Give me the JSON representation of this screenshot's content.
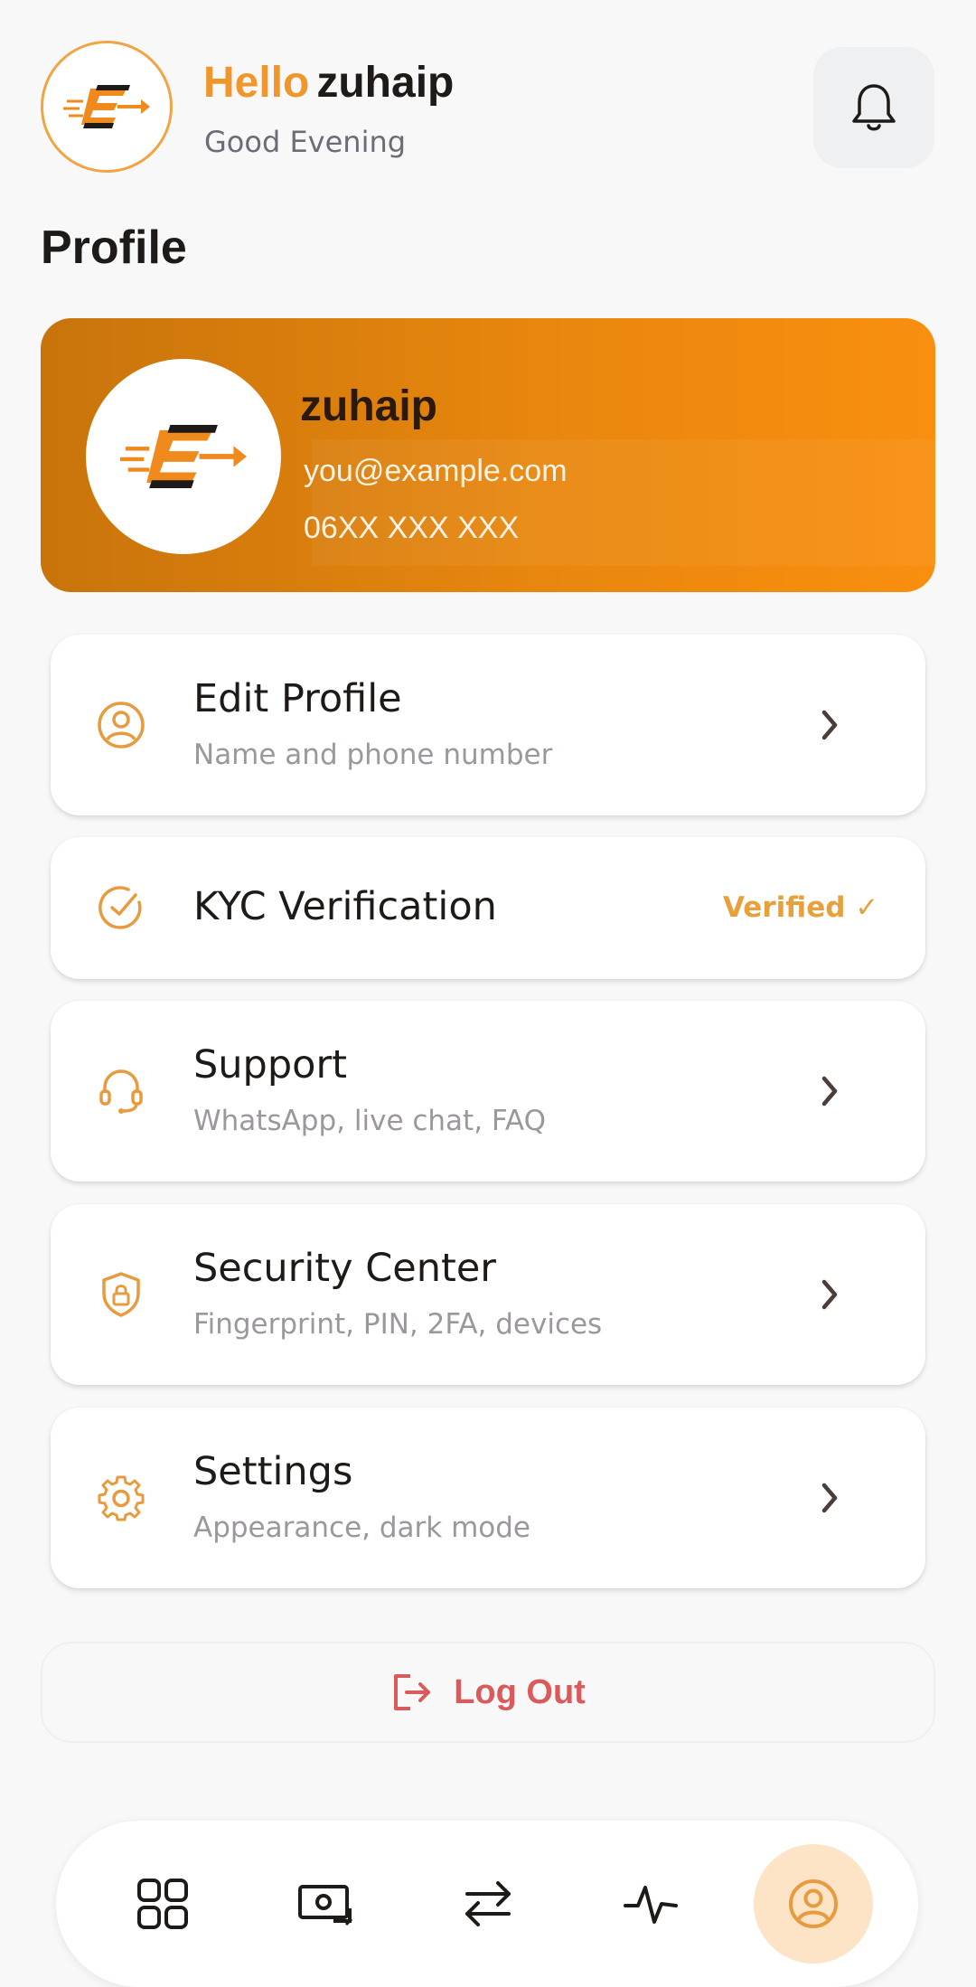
{
  "header": {
    "hello": "Hello",
    "username": "zuhaip",
    "greeting": "Good Evening",
    "notification_icon": "bell-icon"
  },
  "page_title": "Profile",
  "profile": {
    "name": "zuhaip",
    "email": "you@example.com",
    "phone": "06XX XXX XXX"
  },
  "menu": [
    {
      "id": "edit-profile",
      "icon": "user-circle-icon",
      "title": "Edit Profile",
      "subtitle": "Name and phone number"
    },
    {
      "id": "kyc",
      "icon": "check-circle-icon",
      "title": "KYC Verification",
      "status": "Verified ✓"
    },
    {
      "id": "support",
      "icon": "headset-icon",
      "title": "Support",
      "subtitle": "WhatsApp, live chat, FAQ"
    },
    {
      "id": "security",
      "icon": "shield-lock-icon",
      "title": "Security Center",
      "subtitle": "Fingerprint, PIN, 2FA, devices"
    },
    {
      "id": "settings",
      "icon": "gear-icon",
      "title": "Settings",
      "subtitle": "Appearance, dark mode"
    }
  ],
  "logout_label": "Log Out",
  "nav": [
    {
      "icon": "grid-icon"
    },
    {
      "icon": "money-icon"
    },
    {
      "icon": "transfer-icon"
    },
    {
      "icon": "activity-icon"
    },
    {
      "icon": "profile-icon",
      "active": true
    }
  ],
  "colors": {
    "accent": "#f0962a",
    "card_start": "#c8740b",
    "card_end": "#f98f0f",
    "logout": "#d95b5b",
    "nav_active_bg": "#fde4c6"
  }
}
